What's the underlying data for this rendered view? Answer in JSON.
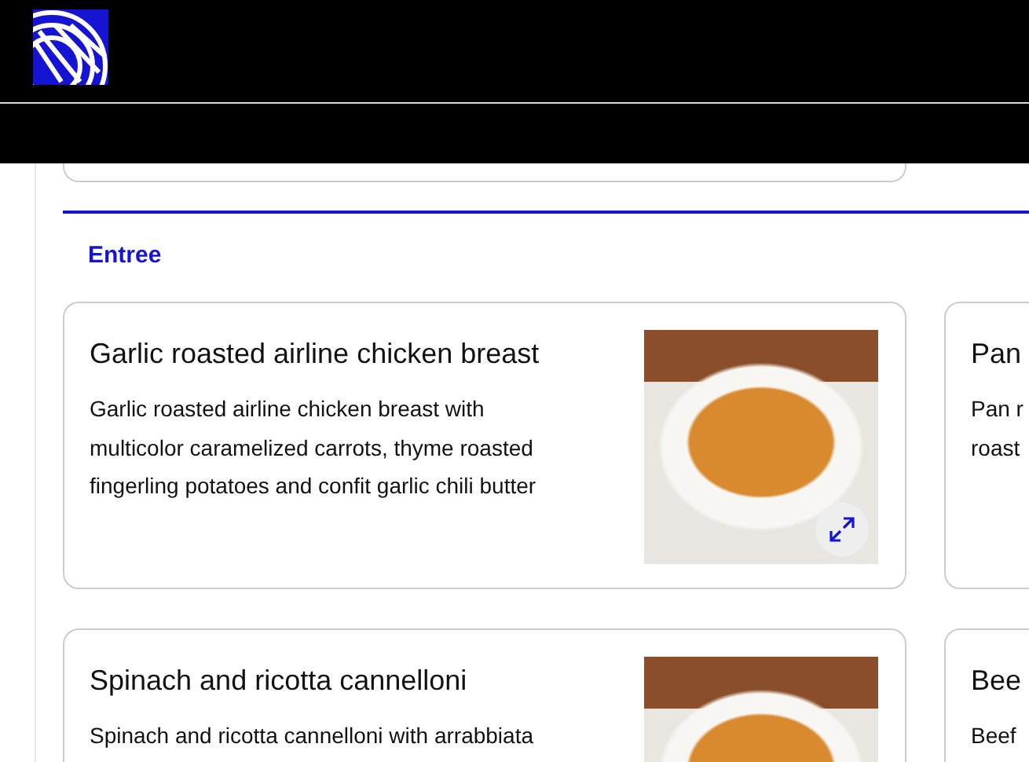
{
  "menu": {
    "category": "Entree",
    "items": [
      {
        "title": "Garlic roasted airline chicken breast",
        "description_lines": [
          "Garlic roasted airline chicken breast with",
          "multicolor caramelized carrots, thyme roasted",
          "fingerling potatoes and confit garlic chili butter"
        ]
      },
      {
        "title": "Pan",
        "description_lines": [
          "Pan r",
          "roast"
        ]
      },
      {
        "title": "Spinach and ricotta cannelloni",
        "description_lines": [
          "Spinach and ricotta cannelloni with arrabbiata"
        ]
      },
      {
        "title": "Bee",
        "description_lines": [
          "Beef"
        ]
      }
    ]
  }
}
